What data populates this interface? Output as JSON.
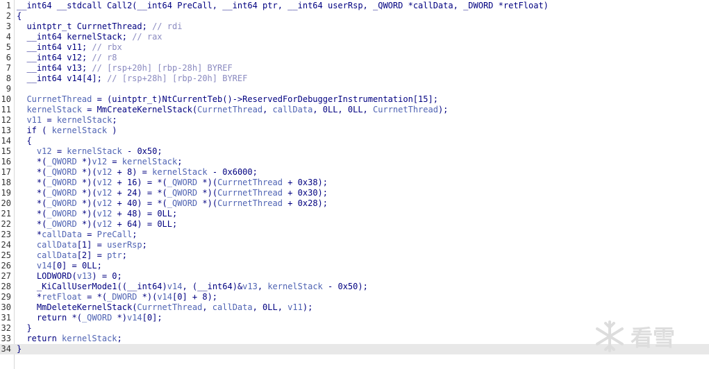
{
  "editor": {
    "current_line": 34,
    "lines": [
      {
        "n": "1",
        "tokens": [
          [
            "kw",
            "__int64 __stdcall "
          ],
          [
            "fn",
            "Call2"
          ],
          [
            "pun",
            "("
          ],
          [
            "kw",
            "__int64 "
          ],
          [
            "fn",
            "PreCall"
          ],
          [
            "pun",
            ", "
          ],
          [
            "kw",
            "__int64 "
          ],
          [
            "fn",
            "ptr"
          ],
          [
            "pun",
            ", "
          ],
          [
            "kw",
            "__int64 "
          ],
          [
            "fn",
            "userRsp"
          ],
          [
            "pun",
            ", "
          ],
          [
            "kw",
            "_QWORD "
          ],
          [
            "pun",
            "*"
          ],
          [
            "fn",
            "callData"
          ],
          [
            "pun",
            ", "
          ],
          [
            "kw",
            "_DWORD "
          ],
          [
            "pun",
            "*"
          ],
          [
            "fn",
            "retFloat"
          ],
          [
            "pun",
            ")"
          ]
        ]
      },
      {
        "n": "2",
        "tokens": [
          [
            "pun",
            "{"
          ]
        ]
      },
      {
        "n": "3",
        "tokens": [
          [
            "pun",
            "  "
          ],
          [
            "kw",
            "uintptr_t "
          ],
          [
            "fn",
            "CurrnetThread"
          ],
          [
            "pun",
            "; "
          ],
          [
            "cmt",
            "// rdi"
          ]
        ]
      },
      {
        "n": "4",
        "tokens": [
          [
            "pun",
            "  "
          ],
          [
            "kw",
            "__int64 "
          ],
          [
            "fn",
            "kernelStack"
          ],
          [
            "pun",
            "; "
          ],
          [
            "cmt",
            "// rax"
          ]
        ]
      },
      {
        "n": "5",
        "tokens": [
          [
            "pun",
            "  "
          ],
          [
            "kw",
            "__int64 "
          ],
          [
            "fn",
            "v11"
          ],
          [
            "pun",
            "; "
          ],
          [
            "cmt",
            "// rbx"
          ]
        ]
      },
      {
        "n": "6",
        "tokens": [
          [
            "pun",
            "  "
          ],
          [
            "kw",
            "__int64 "
          ],
          [
            "fn",
            "v12"
          ],
          [
            "pun",
            "; "
          ],
          [
            "cmt",
            "// r8"
          ]
        ]
      },
      {
        "n": "7",
        "tokens": [
          [
            "pun",
            "  "
          ],
          [
            "kw",
            "__int64 "
          ],
          [
            "fn",
            "v13"
          ],
          [
            "pun",
            "; "
          ],
          [
            "cmt",
            "// [rsp+20h] [rbp-28h] BYREF"
          ]
        ]
      },
      {
        "n": "8",
        "tokens": [
          [
            "pun",
            "  "
          ],
          [
            "kw",
            "__int64 "
          ],
          [
            "fn",
            "v14"
          ],
          [
            "pun",
            "[4]; "
          ],
          [
            "cmt",
            "// [rsp+28h] [rbp-20h] BYREF"
          ]
        ]
      },
      {
        "n": "9",
        "tokens": []
      },
      {
        "n": "10",
        "tokens": [
          [
            "pun",
            "  "
          ],
          [
            "var",
            "CurrnetThread"
          ],
          [
            "pun",
            " = ("
          ],
          [
            "kw",
            "uintptr_t"
          ],
          [
            "pun",
            ")"
          ],
          [
            "fn",
            "NtCurrentTeb"
          ],
          [
            "pun",
            "()->"
          ],
          [
            "fn",
            "ReservedForDebuggerInstrumentation"
          ],
          [
            "pun",
            "[15];"
          ]
        ]
      },
      {
        "n": "11",
        "tokens": [
          [
            "pun",
            "  "
          ],
          [
            "var",
            "kernelStack"
          ],
          [
            "pun",
            " = "
          ],
          [
            "fn",
            "MmCreateKernelStack"
          ],
          [
            "pun",
            "("
          ],
          [
            "var",
            "CurrnetThread"
          ],
          [
            "pun",
            ", "
          ],
          [
            "var",
            "callData"
          ],
          [
            "pun",
            ", 0LL, 0LL, "
          ],
          [
            "var",
            "CurrnetThread"
          ],
          [
            "pun",
            ");"
          ]
        ]
      },
      {
        "n": "12",
        "tokens": [
          [
            "pun",
            "  "
          ],
          [
            "var",
            "v11"
          ],
          [
            "pun",
            " = "
          ],
          [
            "var",
            "kernelStack"
          ],
          [
            "pun",
            ";"
          ]
        ]
      },
      {
        "n": "13",
        "tokens": [
          [
            "pun",
            "  "
          ],
          [
            "kw",
            "if"
          ],
          [
            "pun",
            " ( "
          ],
          [
            "var",
            "kernelStack"
          ],
          [
            "pun",
            " )"
          ]
        ]
      },
      {
        "n": "14",
        "tokens": [
          [
            "pun",
            "  {"
          ]
        ]
      },
      {
        "n": "15",
        "tokens": [
          [
            "pun",
            "    "
          ],
          [
            "var",
            "v12"
          ],
          [
            "pun",
            " = "
          ],
          [
            "var",
            "kernelStack"
          ],
          [
            "pun",
            " - 0x50;"
          ]
        ]
      },
      {
        "n": "16",
        "tokens": [
          [
            "pun",
            "    *("
          ],
          [
            "glob",
            "_QWORD "
          ],
          [
            "pun",
            "*)"
          ],
          [
            "var",
            "v12"
          ],
          [
            "pun",
            " = "
          ],
          [
            "var",
            "kernelStack"
          ],
          [
            "pun",
            ";"
          ]
        ]
      },
      {
        "n": "17",
        "tokens": [
          [
            "pun",
            "    *("
          ],
          [
            "glob",
            "_QWORD "
          ],
          [
            "pun",
            "*)("
          ],
          [
            "var",
            "v12"
          ],
          [
            "pun",
            " + 8) = "
          ],
          [
            "var",
            "kernelStack"
          ],
          [
            "pun",
            " - 0x6000;"
          ]
        ]
      },
      {
        "n": "18",
        "tokens": [
          [
            "pun",
            "    *("
          ],
          [
            "glob",
            "_QWORD "
          ],
          [
            "pun",
            "*)("
          ],
          [
            "var",
            "v12"
          ],
          [
            "pun",
            " + 16) = *("
          ],
          [
            "glob",
            "_QWORD "
          ],
          [
            "pun",
            "*)("
          ],
          [
            "var",
            "CurrnetThread"
          ],
          [
            "pun",
            " + 0x38);"
          ]
        ]
      },
      {
        "n": "19",
        "tokens": [
          [
            "pun",
            "    *("
          ],
          [
            "glob",
            "_QWORD "
          ],
          [
            "pun",
            "*)("
          ],
          [
            "var",
            "v12"
          ],
          [
            "pun",
            " + 24) = *("
          ],
          [
            "glob",
            "_QWORD "
          ],
          [
            "pun",
            "*)("
          ],
          [
            "var",
            "CurrnetThread"
          ],
          [
            "pun",
            " + 0x30);"
          ]
        ]
      },
      {
        "n": "20",
        "tokens": [
          [
            "pun",
            "    *("
          ],
          [
            "glob",
            "_QWORD "
          ],
          [
            "pun",
            "*)("
          ],
          [
            "var",
            "v12"
          ],
          [
            "pun",
            " + 40) = *("
          ],
          [
            "glob",
            "_QWORD "
          ],
          [
            "pun",
            "*)("
          ],
          [
            "var",
            "CurrnetThread"
          ],
          [
            "pun",
            " + 0x28);"
          ]
        ]
      },
      {
        "n": "21",
        "tokens": [
          [
            "pun",
            "    *("
          ],
          [
            "glob",
            "_OWORD "
          ],
          [
            "pun",
            "*)("
          ],
          [
            "var",
            "v12"
          ],
          [
            "pun",
            " + 48) = 0LL;"
          ]
        ]
      },
      {
        "n": "22",
        "tokens": [
          [
            "pun",
            "    *("
          ],
          [
            "glob",
            "_OWORD "
          ],
          [
            "pun",
            "*)("
          ],
          [
            "var",
            "v12"
          ],
          [
            "pun",
            " + 64) = 0LL;"
          ]
        ]
      },
      {
        "n": "23",
        "tokens": [
          [
            "pun",
            "    *"
          ],
          [
            "var",
            "callData"
          ],
          [
            "pun",
            " = "
          ],
          [
            "var",
            "PreCall"
          ],
          [
            "pun",
            ";"
          ]
        ]
      },
      {
        "n": "24",
        "tokens": [
          [
            "pun",
            "    "
          ],
          [
            "var",
            "callData"
          ],
          [
            "pun",
            "[1] = "
          ],
          [
            "var",
            "userRsp"
          ],
          [
            "pun",
            ";"
          ]
        ]
      },
      {
        "n": "25",
        "tokens": [
          [
            "pun",
            "    "
          ],
          [
            "var",
            "callData"
          ],
          [
            "pun",
            "[2] = "
          ],
          [
            "var",
            "ptr"
          ],
          [
            "pun",
            ";"
          ]
        ]
      },
      {
        "n": "26",
        "tokens": [
          [
            "pun",
            "    "
          ],
          [
            "var",
            "v14"
          ],
          [
            "pun",
            "[0] = 0LL;"
          ]
        ]
      },
      {
        "n": "27",
        "tokens": [
          [
            "pun",
            "    "
          ],
          [
            "fn",
            "LODWORD"
          ],
          [
            "pun",
            "("
          ],
          [
            "var",
            "v13"
          ],
          [
            "pun",
            ") = 0;"
          ]
        ]
      },
      {
        "n": "28",
        "tokens": [
          [
            "pun",
            "    "
          ],
          [
            "fn",
            "_KiCallUserMode1"
          ],
          [
            "pun",
            "(("
          ],
          [
            "kw",
            "__int64"
          ],
          [
            "pun",
            ")"
          ],
          [
            "var",
            "v14"
          ],
          [
            "pun",
            ", ("
          ],
          [
            "kw",
            "__int64"
          ],
          [
            "pun",
            ")&"
          ],
          [
            "var",
            "v13"
          ],
          [
            "pun",
            ", "
          ],
          [
            "var",
            "kernelStack"
          ],
          [
            "pun",
            " - 0x50);"
          ]
        ]
      },
      {
        "n": "29",
        "tokens": [
          [
            "pun",
            "    *"
          ],
          [
            "var",
            "retFloat"
          ],
          [
            "pun",
            " = *("
          ],
          [
            "glob",
            "_DWORD "
          ],
          [
            "pun",
            "*)("
          ],
          [
            "var",
            "v14"
          ],
          [
            "pun",
            "[0] + 8);"
          ]
        ]
      },
      {
        "n": "30",
        "tokens": [
          [
            "pun",
            "    "
          ],
          [
            "fn",
            "MmDeleteKernelStack"
          ],
          [
            "pun",
            "("
          ],
          [
            "var",
            "CurrnetThread"
          ],
          [
            "pun",
            ", "
          ],
          [
            "var",
            "callData"
          ],
          [
            "pun",
            ", 0LL, "
          ],
          [
            "var",
            "v11"
          ],
          [
            "pun",
            ");"
          ]
        ]
      },
      {
        "n": "31",
        "tokens": [
          [
            "pun",
            "    "
          ],
          [
            "kw",
            "return"
          ],
          [
            "pun",
            " *("
          ],
          [
            "glob",
            "_QWORD "
          ],
          [
            "pun",
            "*)"
          ],
          [
            "var",
            "v14"
          ],
          [
            "pun",
            "[0];"
          ]
        ]
      },
      {
        "n": "32",
        "tokens": [
          [
            "pun",
            "  }"
          ]
        ]
      },
      {
        "n": "33",
        "tokens": [
          [
            "pun",
            "  "
          ],
          [
            "kw",
            "return"
          ],
          [
            "pun",
            " "
          ],
          [
            "var",
            "kernelStack"
          ],
          [
            "pun",
            ";"
          ]
        ]
      },
      {
        "n": "34",
        "tokens": [
          [
            "pun",
            "}"
          ]
        ]
      }
    ]
  },
  "watermark": {
    "icon": "snowflake-icon",
    "text": "看雪",
    "color": "#dddddd"
  }
}
